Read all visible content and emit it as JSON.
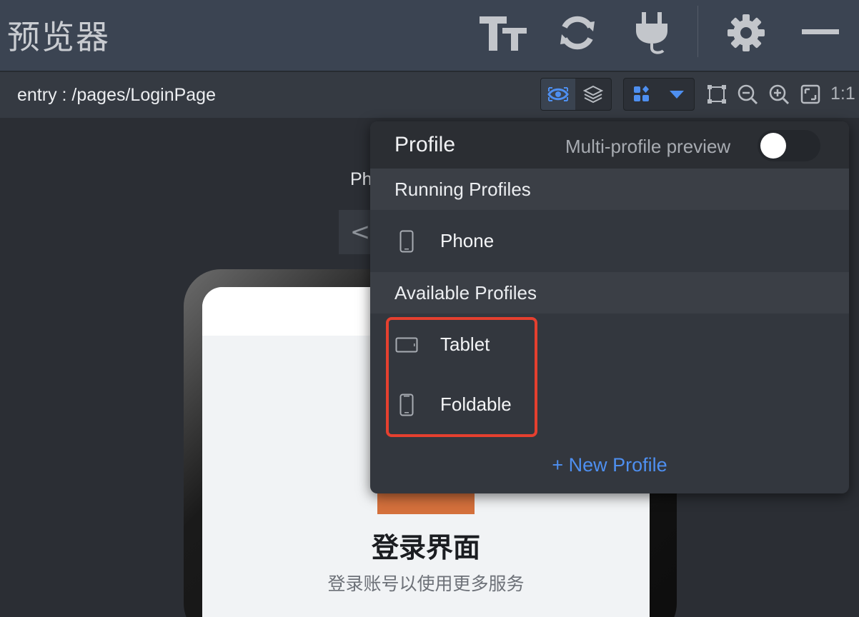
{
  "app": {
    "title": "预览器"
  },
  "titlebar": {
    "icons": [
      "font-size-icon",
      "refresh-icon",
      "plug-icon",
      "gear-icon",
      "minimize-icon"
    ]
  },
  "subbar": {
    "path": "entry : /pages/LoginPage",
    "ratio_label": "1:1",
    "icons": [
      "eye-icon",
      "layers-icon",
      "profiles-grid-icon",
      "dropdown-arrow-icon",
      "bounding-box-icon",
      "zoom-out-icon",
      "zoom-in-icon",
      "fit-screen-icon"
    ]
  },
  "canvas": {
    "device_label": "Ph",
    "back_glyph": "<"
  },
  "screen": {
    "title": "登录界面",
    "subtitle": "登录账号以使用更多服务"
  },
  "popup": {
    "title": "Profile",
    "multi_label": "Multi-profile preview",
    "multi_enabled": false,
    "running_header": "Running Profiles",
    "running": [
      {
        "label": "Phone",
        "icon": "phone-icon"
      }
    ],
    "available_header": "Available Profiles",
    "available": [
      {
        "label": "Tablet",
        "icon": "tablet-icon"
      },
      {
        "label": "Foldable",
        "icon": "foldable-icon"
      }
    ],
    "new_profile": "+ New Profile"
  },
  "colors": {
    "accent": "#4e8ff0",
    "highlight": "#e5402f",
    "titlebar": "#3b4452"
  }
}
